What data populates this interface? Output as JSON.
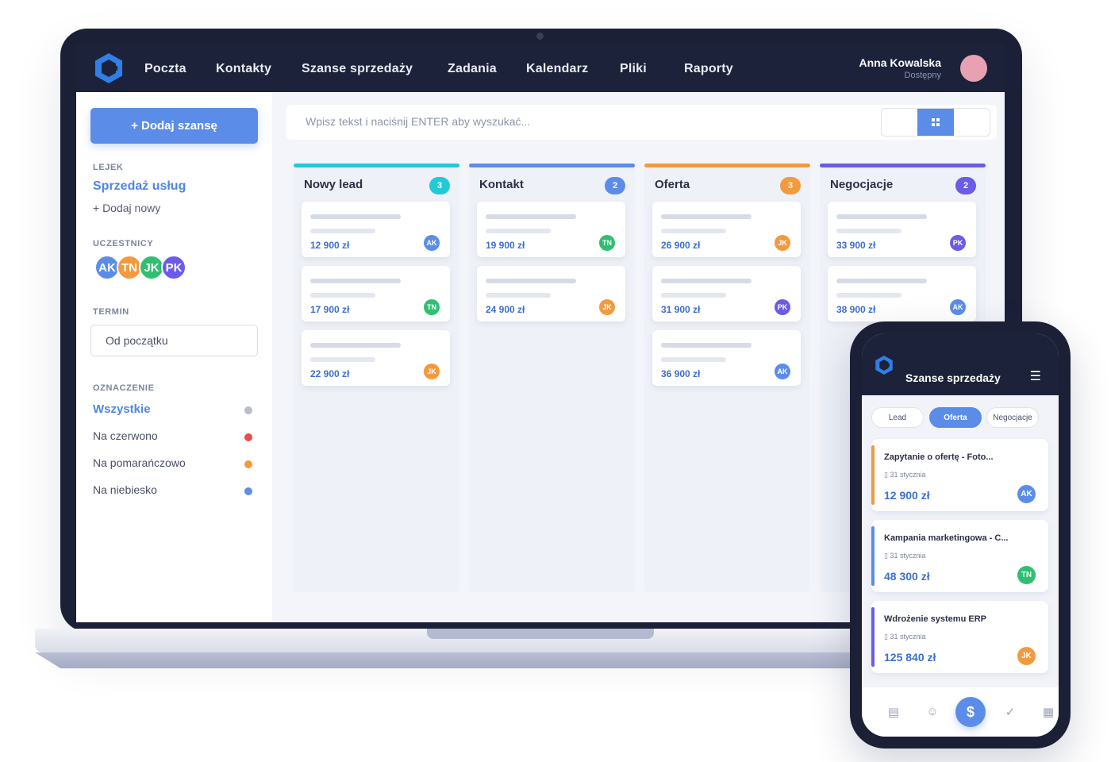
{
  "colors": {
    "accent": "#5b8de8",
    "nav_bg": "#1c2239",
    "teal": "#22c9d9",
    "blue": "#5b8de8",
    "orange": "#f39a3d",
    "purple": "#6b5be8",
    "green": "#2fbf71",
    "red": "#ef4b4b"
  },
  "nav": {
    "items": [
      "Poczta",
      "Kontakty",
      "Szanse sprzedaży",
      "Zadania",
      "Kalendarz",
      "Pliki",
      "Raporty"
    ]
  },
  "user": {
    "name": "Anna Kowalska",
    "status": "Dostępny"
  },
  "sidebar": {
    "add_button": "+ Dodaj szansę",
    "pipeline_label": "LEJEK",
    "pipeline_name": "Sprzedaż usług",
    "pipeline_add": "+ Dodaj nowy",
    "participants_label": "UCZESTNICY",
    "participants": [
      {
        "initials": "AK",
        "color": "#5b8de8"
      },
      {
        "initials": "TN",
        "color": "#f39a3d"
      },
      {
        "initials": "JK",
        "color": "#2fbf71"
      },
      {
        "initials": "PK",
        "color": "#6b5be8"
      }
    ],
    "term_label": "TERMIN",
    "term_value": "Od początku",
    "labels_label": "OZNACZENIE",
    "labels": [
      {
        "text": "Wszystkie",
        "color": "#b8bdcc"
      },
      {
        "text": "Na czerwono",
        "color": "#ef4b4b"
      },
      {
        "text": "Na pomarańczowo",
        "color": "#f39a3d"
      },
      {
        "text": "Na niebiesko",
        "color": "#5b8de8"
      }
    ]
  },
  "search": {
    "placeholder": "Wpisz tekst i naciśnij ENTER aby wyszukać..."
  },
  "view_toggle": {
    "active_icon": "grid-icon"
  },
  "columns": [
    {
      "title": "Nowy lead",
      "count": "3",
      "color": "#22c9d9",
      "cards": [
        {
          "amount": "12 900 zł",
          "owner": "AK",
          "owner_color": "#5b8de8"
        },
        {
          "amount": "17 900 zł",
          "owner": "TN",
          "owner_color": "#2fbf71"
        },
        {
          "amount": "22 900 zł",
          "owner": "JK",
          "owner_color": "#f39a3d"
        }
      ]
    },
    {
      "title": "Kontakt",
      "count": "2",
      "color": "#5b8de8",
      "cards": [
        {
          "amount": "19 900 zł",
          "owner": "TN",
          "owner_color": "#2fbf71"
        },
        {
          "amount": "24 900 zł",
          "owner": "JK",
          "owner_color": "#f39a3d"
        }
      ]
    },
    {
      "title": "Oferta",
      "count": "3",
      "color": "#f39a3d",
      "cards": [
        {
          "amount": "26 900 zł",
          "owner": "JK",
          "owner_color": "#f39a3d"
        },
        {
          "amount": "31 900 zł",
          "owner": "PK",
          "owner_color": "#6b5be8"
        },
        {
          "amount": "36 900 zł",
          "owner": "AK",
          "owner_color": "#5b8de8"
        }
      ]
    },
    {
      "title": "Negocjacje",
      "count": "2",
      "color": "#6b5be8",
      "cards": [
        {
          "amount": "33 900 zł",
          "owner": "PK",
          "owner_color": "#6b5be8"
        },
        {
          "amount": "38 900 zł",
          "owner": "AK",
          "owner_color": "#5b8de8"
        }
      ]
    }
  ],
  "mobile": {
    "title": "Szanse sprzedaży",
    "menu_icon": "hamburger-icon",
    "tabs": [
      "Lead",
      "Oferta",
      "Negocjacje"
    ],
    "active_tab": "Oferta",
    "cards": [
      {
        "name": "Zapytanie o ofertę - Foto...",
        "date": "31 stycznia",
        "amount": "12 900 zł",
        "owner": "AK",
        "owner_color": "#5b8de8",
        "stripe": "#f39a3d"
      },
      {
        "name": "Kampania marketingowa - C...",
        "date": "31 stycznia",
        "amount": "48 300 zł",
        "owner": "TN",
        "owner_color": "#2fbf71",
        "stripe": "#5b8de8"
      },
      {
        "name": "Wdrożenie systemu ERP",
        "date": "31 stycznia",
        "amount": "125 840 zł",
        "owner": "JK",
        "owner_color": "#f39a3d",
        "stripe": "#6b5be8"
      }
    ],
    "bottom_nav": [
      "mail-icon",
      "contacts-icon",
      "dollar-icon",
      "tasks-icon",
      "calendar-icon"
    ]
  }
}
